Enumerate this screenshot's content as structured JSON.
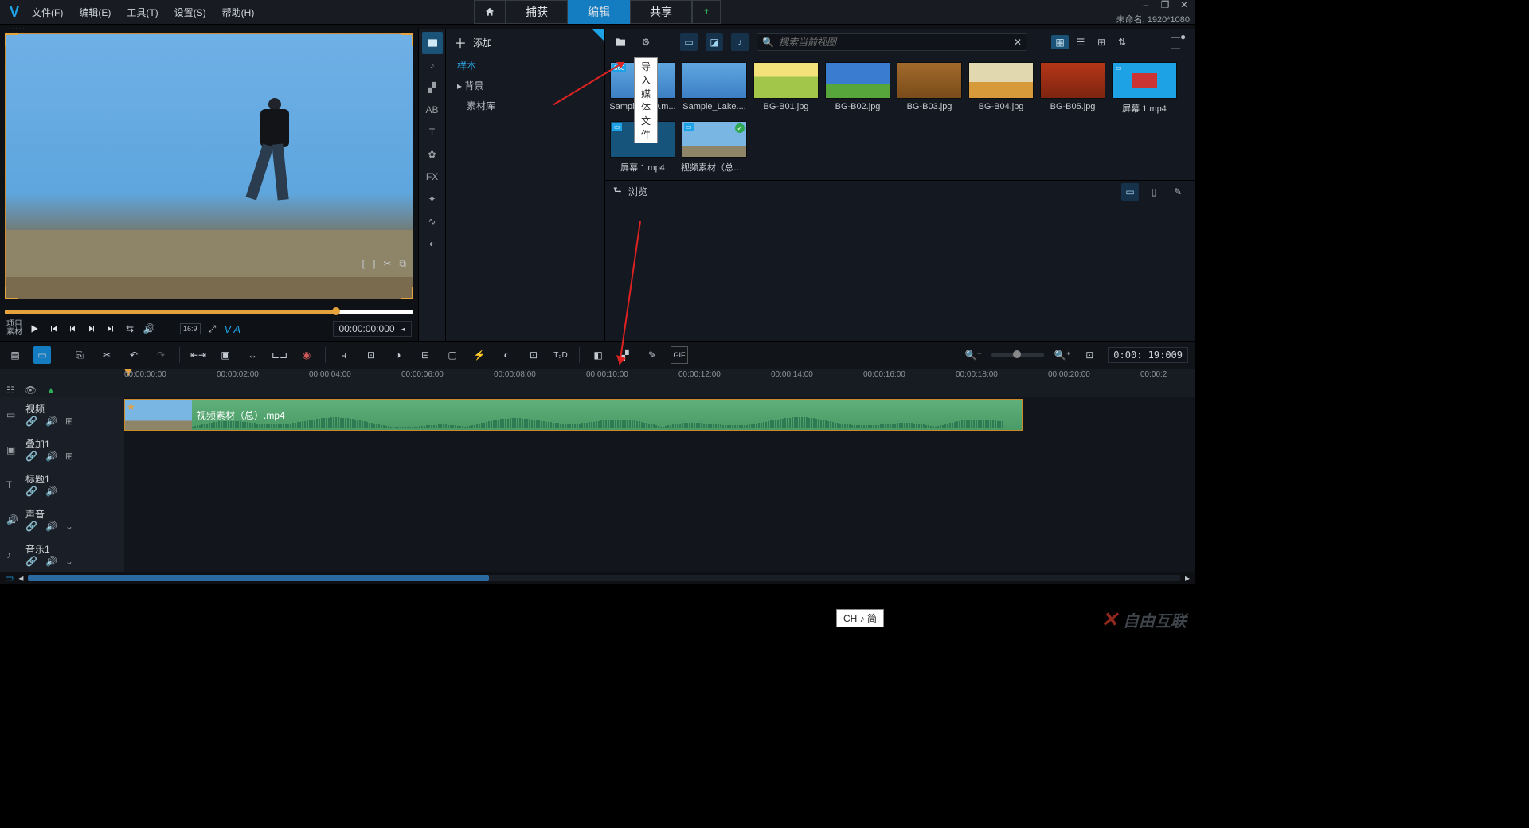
{
  "menu": {
    "file": "文件(F)",
    "edit": "编辑(E)",
    "tools": "工具(T)",
    "settings": "设置(S)",
    "help": "帮助(H)"
  },
  "tabs": {
    "capture": "捕获",
    "edit": "编辑",
    "share": "共享"
  },
  "project": {
    "name": "未命名, 1920*1080"
  },
  "library": {
    "add": "添加",
    "tree": {
      "sample": "样本",
      "background": "背景",
      "assets": "素材库"
    },
    "search_placeholder": "搜索当前视图",
    "import_tooltip": "导入媒体文件",
    "browse": "浏览",
    "items": [
      {
        "n": "Sample_360.m..."
      },
      {
        "n": "Sample_Lake...."
      },
      {
        "n": "BG-B01.jpg"
      },
      {
        "n": "BG-B02.jpg"
      },
      {
        "n": "BG-B03.jpg"
      },
      {
        "n": "BG-B04.jpg"
      },
      {
        "n": "BG-B05.jpg"
      },
      {
        "n": "屏幕 1.mp4"
      },
      {
        "n": "屏幕 1.mp4"
      },
      {
        "n": "视频素材（总）...."
      }
    ]
  },
  "preview": {
    "lbl1": "项目",
    "lbl2": "素材",
    "aspect": "16:9",
    "va": "V A",
    "timecode": "00:00:00:000"
  },
  "timeline": {
    "tc": "0:00: 19:009",
    "ruler": [
      "00:00:00:00",
      "00:00:02:00",
      "00:00:04:00",
      "00:00:06:00",
      "00:00:08:00",
      "00:00:10:00",
      "00:00:12:00",
      "00:00:14:00",
      "00:00:16:00",
      "00:00:18:00",
      "00:00:20:00",
      "00:00:2"
    ],
    "tracks": [
      {
        "name": "视频",
        "extras": true
      },
      {
        "name": "叠加1",
        "extras": true
      },
      {
        "name": "标题1",
        "extras": false
      },
      {
        "name": "声音",
        "extras": false,
        "chev": true
      },
      {
        "name": "音乐1",
        "extras": false,
        "chev": true
      }
    ],
    "clip": "视频素材（总）.mp4"
  },
  "ime": "CH ♪ 简",
  "watermark": "自由互联"
}
